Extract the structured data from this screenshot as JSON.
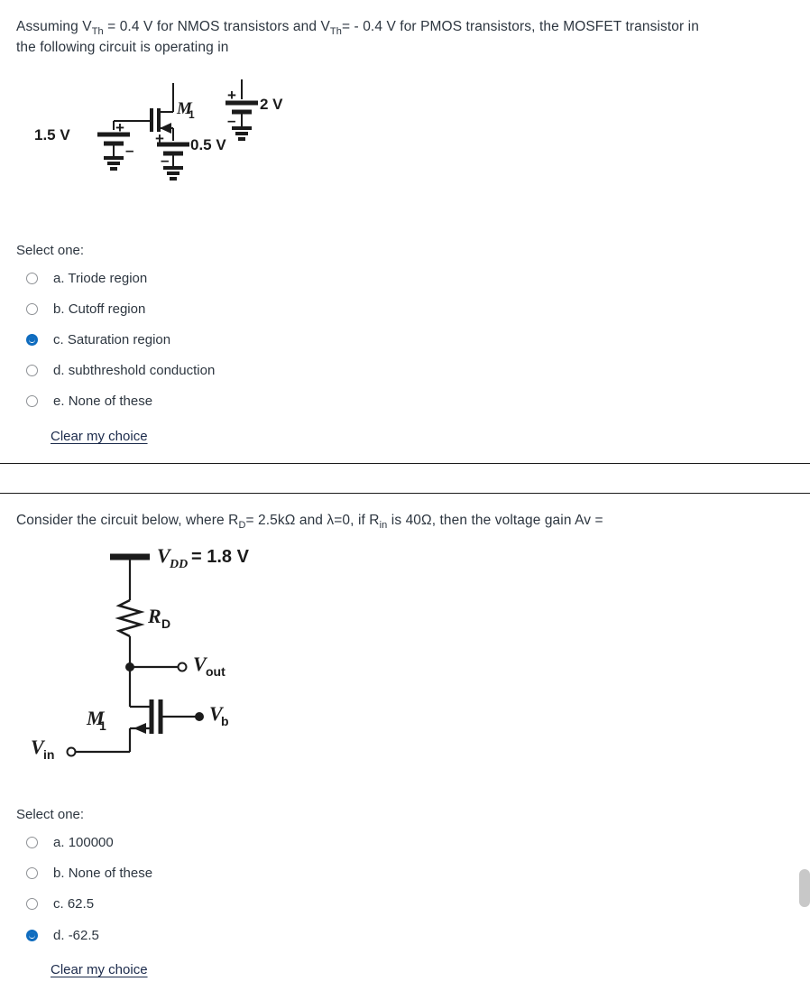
{
  "questions": [
    {
      "id": "q1",
      "prompt_lines": [
        "Assuming V_Th = 0.4 V for NMOS transistors and V_Th= - 0.4 V for PMOS transistors, the MOSFET transistor in",
        "the following circuit is operating in"
      ],
      "prompt_part_1": "Assuming V",
      "prompt_sub_1": "Th",
      "prompt_part_2": " = 0.4 V for NMOS transistors and V",
      "prompt_sub_2": "Th",
      "prompt_part_3": "= - 0.4 V for PMOS transistors, the MOSFET transistor in",
      "prompt_line2": "the following circuit is operating in",
      "select_one_label": "Select one:",
      "options": [
        {
          "key": "a.",
          "label": "Triode region",
          "selected": false
        },
        {
          "key": "b.",
          "label": "Cutoff region",
          "selected": false
        },
        {
          "key": "c.",
          "label": "Saturation region",
          "selected": true
        },
        {
          "key": "d.",
          "label": "subthreshold conduction",
          "selected": false
        },
        {
          "key": "e.",
          "label": "None of these",
          "selected": false
        }
      ],
      "clear_label": "Clear my choice",
      "circuit": {
        "type": "nmos-bias-circuit",
        "source_left": "1.5 V",
        "source_mid": "0.5 V",
        "source_right": "2 V",
        "transistor": "M",
        "transistor_sub": "1",
        "plus": "+",
        "minus": "–"
      }
    },
    {
      "id": "q2",
      "prompt_part_1": "Consider the circuit below, where R",
      "prompt_sub_1": "D",
      "prompt_part_2": "= 2.5kΩ and λ=0,  if R",
      "prompt_sub_2": "in",
      "prompt_part_3": " is 40Ω, then the voltage gain Av =",
      "select_one_label": "Select one:",
      "options": [
        {
          "key": "a.",
          "label": "100000",
          "selected": false
        },
        {
          "key": "b.",
          "label": "None of these",
          "selected": false
        },
        {
          "key": "c.",
          "label": "62.5",
          "selected": false
        },
        {
          "key": "d.",
          "label": "-62.5",
          "selected": true
        }
      ],
      "clear_label": "Clear my choice",
      "circuit": {
        "type": "common-gate-amplifier",
        "vdd_label": "V",
        "vdd_sub": "DD",
        "vdd_value": "= 1.8 V",
        "resistor": "R",
        "resistor_sub": "D",
        "vout": "V",
        "vout_sub": "out",
        "vb": "V",
        "vb_sub": "b",
        "vin": "V",
        "vin_sub": "in",
        "transistor": "M",
        "transistor_sub": "1"
      }
    }
  ],
  "colors": {
    "accent_selected": "#0f6cbf",
    "text": "#2d3640",
    "link": "#1b2a4b",
    "circuit_ink": "#1b1b1b",
    "scrollbar": "#c8c8c8"
  },
  "scrollbar": {
    "name": "vertical-scrollbar-thumb"
  }
}
